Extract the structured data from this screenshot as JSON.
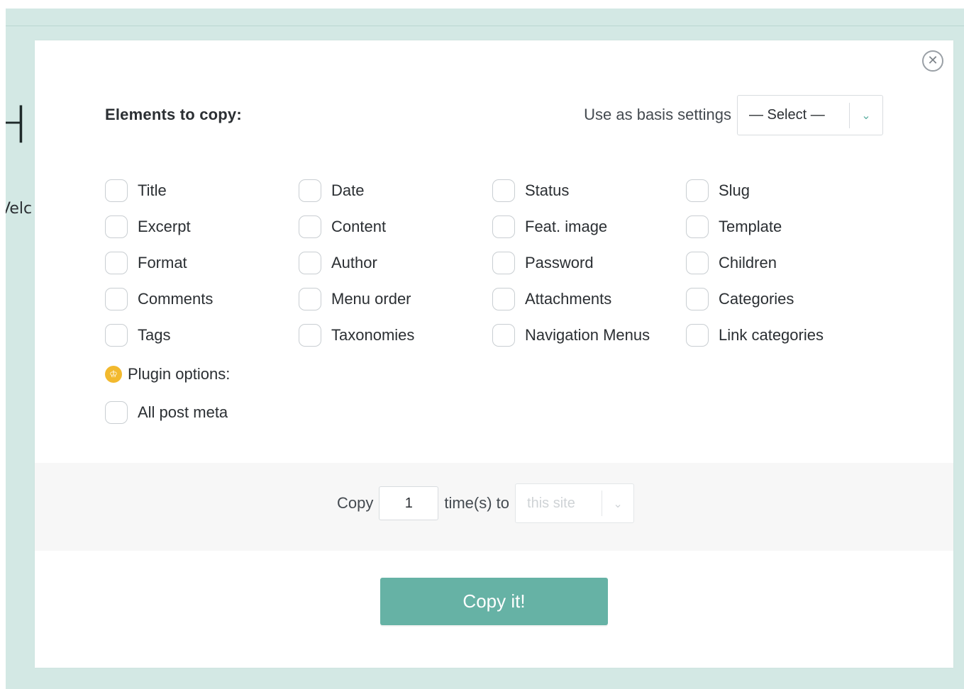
{
  "background": {
    "heading_fragment": "H",
    "welcome_fragment": "Velc"
  },
  "modal": {
    "close_glyph": "✕",
    "section_title": "Elements to copy:",
    "basis": {
      "label": "Use as basis settings",
      "selected": "— Select —",
      "arrow": "⌄"
    },
    "checkboxes": [
      {
        "label": "Title",
        "checked": false
      },
      {
        "label": "Date",
        "checked": false
      },
      {
        "label": "Status",
        "checked": false
      },
      {
        "label": "Slug",
        "checked": false
      },
      {
        "label": "Excerpt",
        "checked": false
      },
      {
        "label": "Content",
        "checked": false
      },
      {
        "label": "Feat. image",
        "checked": false
      },
      {
        "label": "Template",
        "checked": false
      },
      {
        "label": "Format",
        "checked": false
      },
      {
        "label": "Author",
        "checked": false
      },
      {
        "label": "Password",
        "checked": false
      },
      {
        "label": "Children",
        "checked": false
      },
      {
        "label": "Comments",
        "checked": false
      },
      {
        "label": "Menu order",
        "checked": false
      },
      {
        "label": "Attachments",
        "checked": false
      },
      {
        "label": "Categories",
        "checked": false
      },
      {
        "label": "Tags",
        "checked": false
      },
      {
        "label": "Taxonomies",
        "checked": false
      },
      {
        "label": "Navigation Menus",
        "checked": false
      },
      {
        "label": "Link categories",
        "checked": false
      }
    ],
    "plugin_options": {
      "label": "Plugin options:",
      "icon": "crown-icon",
      "icon_glyph": "♔",
      "icon_color": "#f2b92e",
      "items": [
        {
          "label": "All post meta",
          "checked": false
        }
      ]
    },
    "copy_row": {
      "copy_label": "Copy",
      "times_value": "1",
      "times_label": "time(s) to",
      "site_selected": "this site",
      "arrow": "⌄"
    },
    "copy_button_label": "Copy it!"
  },
  "colors": {
    "accent": "#66b2a5",
    "backdrop": "#d3e8e4",
    "checkbox_border": "#c9ced2",
    "footer_band": "#f7f7f7"
  }
}
